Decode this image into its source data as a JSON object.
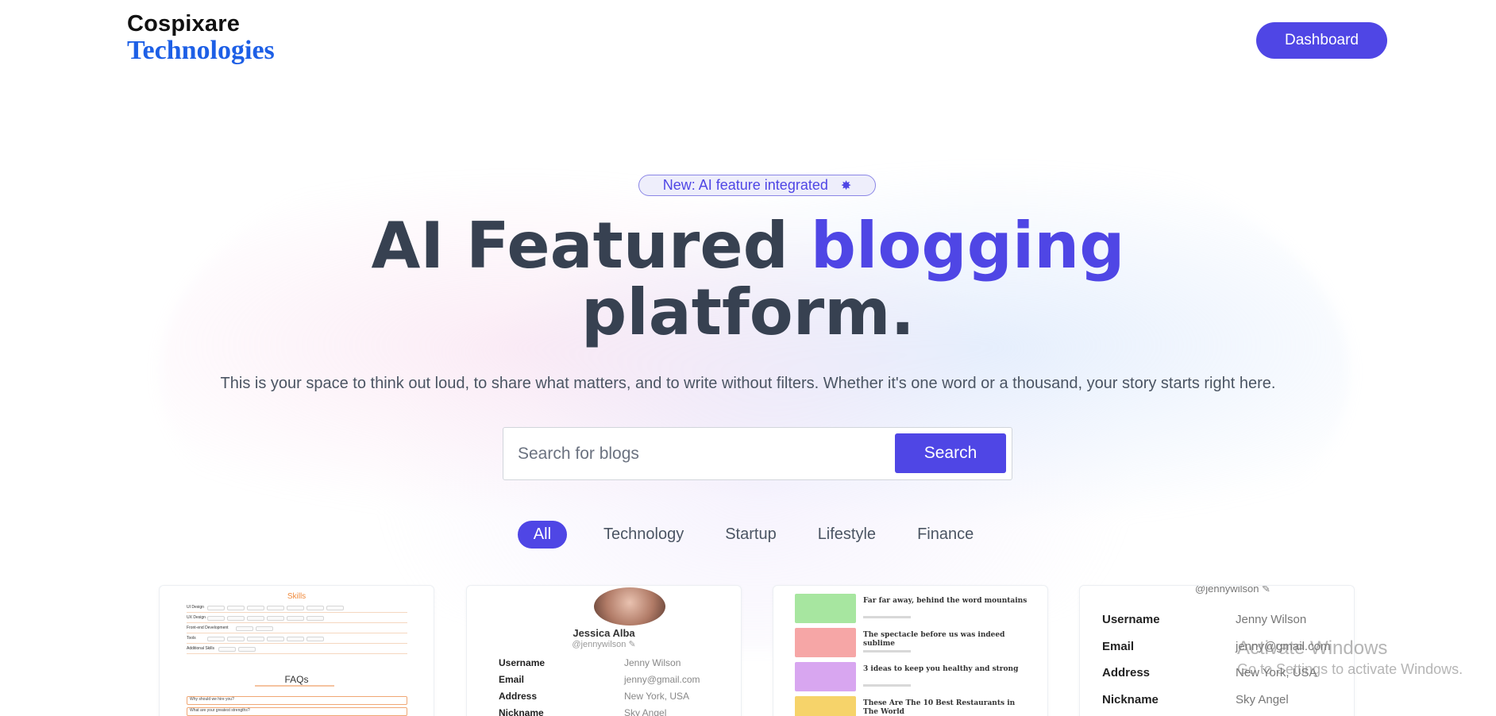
{
  "brand": {
    "line1": "Cospixare",
    "line2": "Technologies"
  },
  "header": {
    "dashboard_label": "Dashboard"
  },
  "hero": {
    "badge_text": "New: AI feature integrated",
    "title_part1": "AI Featured ",
    "title_accent": "blogging",
    "title_part2": "platform.",
    "subtitle": "This is your space to think out loud, to share what matters, and to write without filters. Whether it's one word or a thousand, your story starts right here."
  },
  "search": {
    "placeholder": "Search for blogs",
    "value": "",
    "button_label": "Search"
  },
  "categories": [
    {
      "label": "All",
      "active": true
    },
    {
      "label": "Technology",
      "active": false
    },
    {
      "label": "Startup",
      "active": false
    },
    {
      "label": "Lifestyle",
      "active": false
    },
    {
      "label": "Finance",
      "active": false
    }
  ],
  "cards": {
    "card1": {
      "section_title": "Skills",
      "rows": [
        "UI Design",
        "UX Design",
        "Front-end Development",
        "Tools",
        "Additional Skills"
      ],
      "faq_title": "FAQs",
      "faq_items": [
        "Why should we hire you?",
        "What are your greatest strengths?"
      ]
    },
    "card2": {
      "name": "Jessica Alba",
      "handle": "@jennywilson",
      "fields": [
        {
          "key": "Username",
          "value": "Jenny Wilson"
        },
        {
          "key": "Email",
          "value": "jenny@gmail.com"
        },
        {
          "key": "Address",
          "value": "New York, USA"
        },
        {
          "key": "Nickname",
          "value": "Sky Angel"
        }
      ]
    },
    "card3": {
      "posts": [
        {
          "title": "Far far away, behind the word mountains",
          "color": "#a7e6a0"
        },
        {
          "title": "The spectacle before us was indeed sublime",
          "color": "#f6a6a6"
        },
        {
          "title": "3 ideas to keep you healthy and strong",
          "color": "#d8a6f0"
        },
        {
          "title": "These Are The 10 Best Restaurants in The World",
          "color": "#f6d36a"
        }
      ]
    },
    "card4": {
      "handle": "@jennywilson",
      "fields": [
        {
          "key": "Username",
          "value": "Jenny Wilson"
        },
        {
          "key": "Email",
          "value": "jenny@gmail.com"
        },
        {
          "key": "Address",
          "value": "New York, USA"
        },
        {
          "key": "Nickname",
          "value": "Sky Angel"
        }
      ]
    }
  },
  "watermark": {
    "title": "Activate Windows",
    "subtitle": "Go to Settings to activate Windows."
  },
  "colors": {
    "accent": "#4f46e5",
    "brand_blue": "#1d5fe6"
  }
}
